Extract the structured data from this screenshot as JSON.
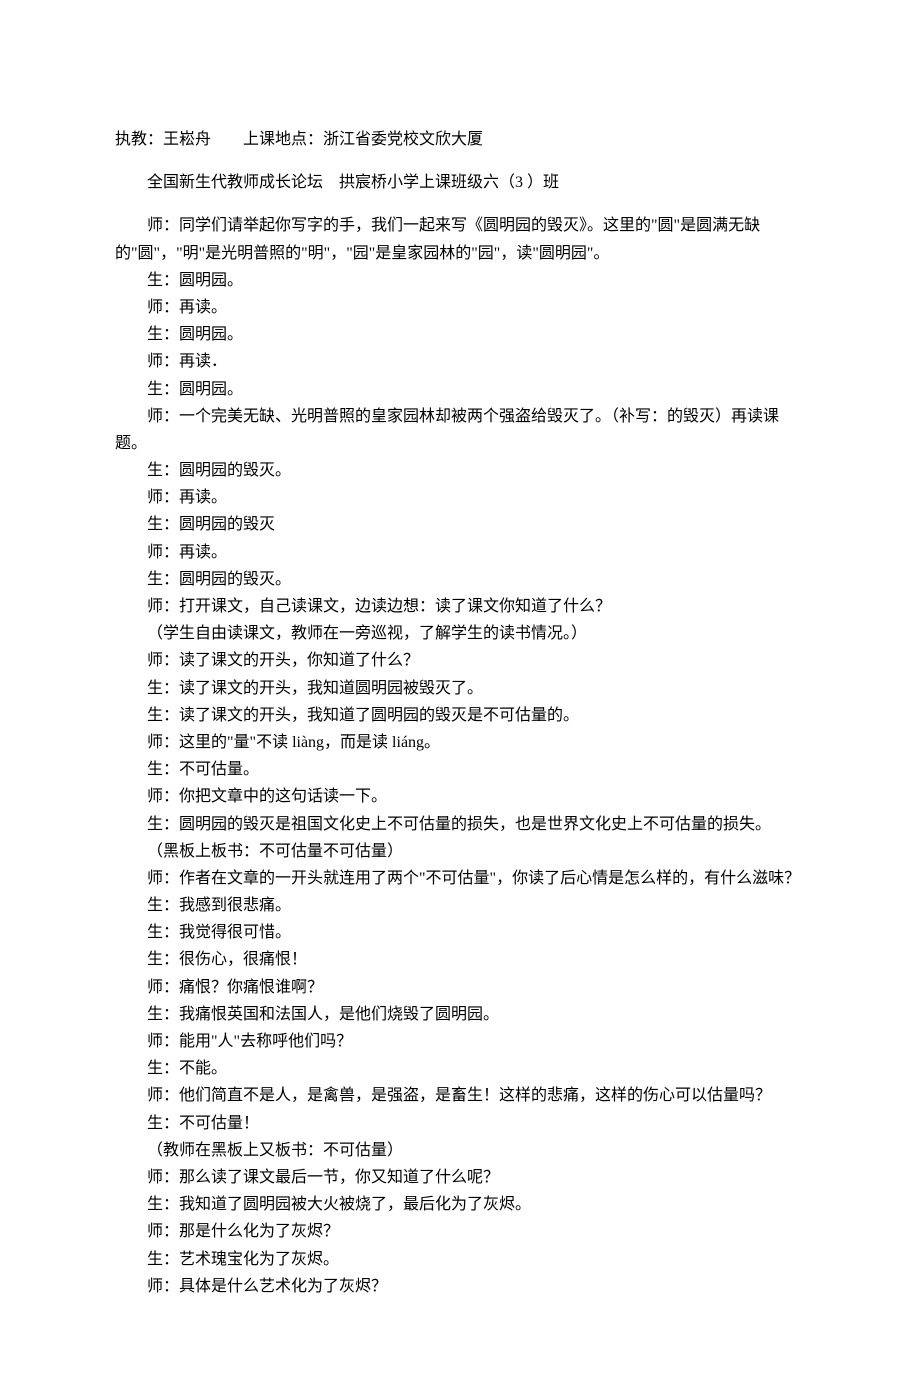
{
  "meta": {
    "line1": "执教：王崧舟  上课地点：浙江省委党校文欣大厦",
    "line2": "全国新生代教师成长论坛 拱宸桥小学上课班级六（3 ）班"
  },
  "lines": [
    "师：同学们请举起你写字的手，我们一起来写《圆明园的毁灭》。这里的\"圆\"是圆满无缺的\"圆\"，\"明\"是光明普照的\"明\"，\"园\"是皇家园林的\"园\"，读\"圆明园\"。",
    "生：圆明园。",
    "师：再读。",
    "生：圆明园。",
    "师：再读．",
    "生：圆明园。",
    "师：一个完美无缺、光明普照的皇家园林却被两个强盗给毁灭了。（补写：的毁灭）再读课题。",
    "生：圆明园的毁灭。",
    "师：再读。",
    "生：圆明园的毁灭",
    "师：再读。",
    "生：圆明园的毁灭。",
    "师：打开课文，自己读课文，边读边想：读了课文你知道了什么？",
    "（学生自由读课文，教师在一旁巡视，了解学生的读书情况。）",
    "师：读了课文的开头，你知道了什么？",
    "生：读了课文的开头，我知道圆明园被毁灭了。",
    "生：读了课文的开头，我知道了圆明园的毁灭是不可估量的。",
    "师：这里的\"量\"不读 liàng，而是读 liáng。",
    "生：不可估量。",
    "师：你把文章中的这句话读一下。",
    "生：圆明园的毁灭是祖国文化史上不可估量的损失，也是世界文化史上不可估量的损失。",
    "（黑板上板书：不可估量不可估量）",
    "师：作者在文章的一开头就连用了两个\"不可估量\"，你读了后心情是怎么样的，有什么滋味？",
    "生：我感到很悲痛。",
    "生：我觉得很可惜。",
    "生：很伤心，很痛恨！",
    "师：痛恨？你痛恨谁啊？",
    "生：我痛恨英国和法国人，是他们烧毁了圆明园。",
    "师：能用\"人\"去称呼他们吗？",
    "生：不能。",
    "师：他们简直不是人，是禽兽，是强盗，是畜生！这样的悲痛，这样的伤心可以估量吗？",
    "生：不可估量！",
    "（教师在黑板上又板书：不可估量）",
    "师：那么读了课文最后一节，你又知道了什么呢？",
    "生：我知道了圆明园被大火被烧了，最后化为了灰烬。",
    "师：那是什么化为了灰烬？",
    "生：艺术瑰宝化为了灰烬。",
    "师：具体是什么艺术化为了灰烬？"
  ]
}
